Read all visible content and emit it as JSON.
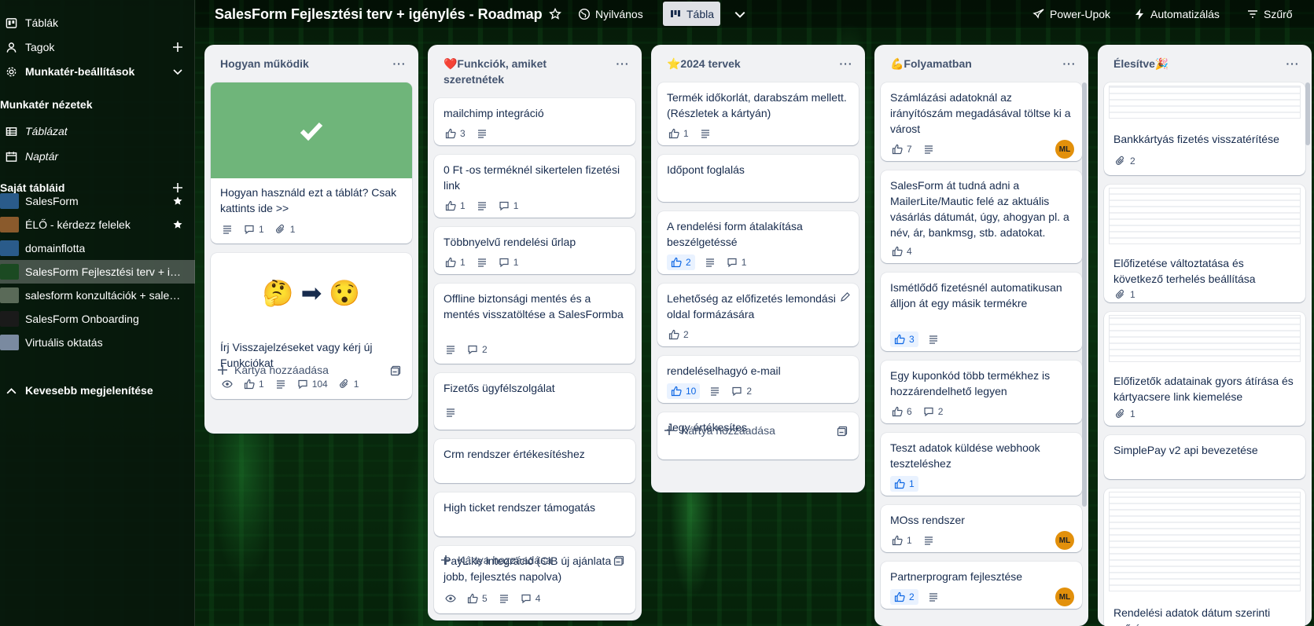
{
  "sidebar": {
    "items": [
      {
        "label": "Táblák",
        "icon": "board-icon"
      },
      {
        "label": "Tagok",
        "icon": "person-icon"
      },
      {
        "label": "Munkatér-beállítások",
        "icon": "gear-icon"
      }
    ],
    "views_heading": "Munkatér nézetek",
    "views": [
      {
        "label": "Táblázat",
        "icon": "table-icon"
      },
      {
        "label": "Naptár",
        "icon": "calendar-icon"
      }
    ],
    "boards_heading": "Saját tábláid",
    "boards": [
      {
        "label": "SalesForm",
        "color": "#2a5b8a"
      },
      {
        "label": "ÉLŐ - kérdezz felelek",
        "color": "#8a5a2c"
      },
      {
        "label": "domainflotta",
        "color": "#2a5b8a"
      },
      {
        "label": "SalesForm Fejlesztési terv + igé...",
        "color": "#1b4a22"
      },
      {
        "label": "salesform konzultációk + sales ...",
        "color": "#5a6a58"
      },
      {
        "label": "SalesForm Onboarding",
        "color": "#1a1a1a"
      },
      {
        "label": "Virtuális oktatás",
        "color": "#7a8aa0"
      }
    ],
    "show_less": "Kevesebb megjelenítése"
  },
  "header": {
    "title": "SalesForm Fejlesztési terv + igénylés - Roadmap",
    "visibility": "Nyilvános",
    "view": "Tábla",
    "power_ups": "Power-Upok",
    "automation": "Automatizálás",
    "filter": "Szűrő"
  },
  "add_card_label": "Kártya hozzáadása",
  "lists": [
    {
      "title": "Hogyan működik",
      "cards": [
        {
          "title": "Hogyan használd ezt a táblát? Csak kattints ide >>",
          "desc": true,
          "comments": "1",
          "attachments": "1",
          "cover_color": "#6fb57a"
        },
        {
          "title": "Írj Visszajelzéseket vagy kérj új Funkciókat",
          "emoji": "🤔 ➡ 😯",
          "watching": true,
          "votes": "1",
          "desc": true,
          "comments": "104",
          "attachments": "1"
        }
      ]
    },
    {
      "title": "❤️Funkciók, amiket szeretnétek",
      "cards": [
        {
          "title": "mailchimp integráció",
          "votes": "3",
          "desc": true
        },
        {
          "title": "0 Ft -os terméknél sikertelen fizetési link",
          "votes": "1",
          "desc": true,
          "comments": "1"
        },
        {
          "title": "Többnyelvű rendelési űrlap",
          "votes": "1",
          "desc": true,
          "comments": "1"
        },
        {
          "title": "Offline biztonsági mentés és a mentés visszatöltése a SalesFormba",
          "desc": true,
          "comments": "2"
        },
        {
          "title": "Fizetős ügyfélszolgálat",
          "desc": true
        },
        {
          "title": "Crm rendszer értékesítéshez"
        },
        {
          "title": "High ticket rendszer támogatás"
        },
        {
          "title": "PayLike integráció (CiB új ajánlata jobb, fejlesztés napolva)",
          "watching": true,
          "votes": "5",
          "desc": true,
          "comments": "4"
        }
      ]
    },
    {
      "title": "⭐2024 tervek",
      "cards": [
        {
          "title": "Termék időkorlát, darabszám mellett. (Részletek a kártyán)",
          "votes": "1",
          "desc": true
        },
        {
          "title": "Időpont foglalás"
        },
        {
          "title": "A rendelési form átalakítása beszélgetéssé",
          "votes": "2",
          "voted": true,
          "desc": true,
          "comments": "1"
        },
        {
          "title": "Lehetőség az előfizetés lemondási oldal formázására",
          "votes": "2"
        },
        {
          "title": "rendeléselhagyó e-mail",
          "votes": "10",
          "voted": true,
          "desc": true,
          "comments": "2"
        },
        {
          "title": "Jegy értékesítes"
        }
      ]
    },
    {
      "title": "💪Folyamatban",
      "cards": [
        {
          "title": "Számlázási adatoknál az irányítószám megadásával töltse ki a várost",
          "votes": "7",
          "desc": true,
          "member": "ML"
        },
        {
          "title": "SalesForm át tudná adni a MailerLite/Mautic felé az aktuális vásárlás dátumát, úgy, ahogyan pl. a név, ár, bankmsg, stb. adatokat.",
          "votes": "4"
        },
        {
          "title": "Ismétlődő fizetésnél automatikusan álljon át egy másik termékre",
          "votes": "3",
          "voted": true,
          "desc": true
        },
        {
          "title": "Egy kuponkód több termékhez is hozzárendelhető legyen",
          "votes": "6",
          "comments": "2"
        },
        {
          "title": "Teszt adatok küldése webhook teszteléshez",
          "votes": "1",
          "voted": true
        },
        {
          "title": "MOss rendszer",
          "votes": "1",
          "desc": true,
          "member": "ML"
        },
        {
          "title": "Partnerprogram fejlesztése",
          "votes": "2",
          "voted": true,
          "desc": true,
          "member": "ML"
        }
      ]
    },
    {
      "title": "Élesítve🎉",
      "cards": [
        {
          "title": "Bankkártyás fizetés visszatérítése",
          "attachments": "2"
        },
        {
          "title": "Előfizetése változtatása és következő terhelés beállítása",
          "attachments": "1"
        },
        {
          "title": "Előfizetők adatainak gyors átírása és kártyacsere link kiemelése",
          "attachments": "1"
        },
        {
          "title": "SimplePay v2 api bevezetése"
        },
        {
          "title": "Rendelési adatok dátum szerinti szűrése"
        }
      ]
    }
  ]
}
